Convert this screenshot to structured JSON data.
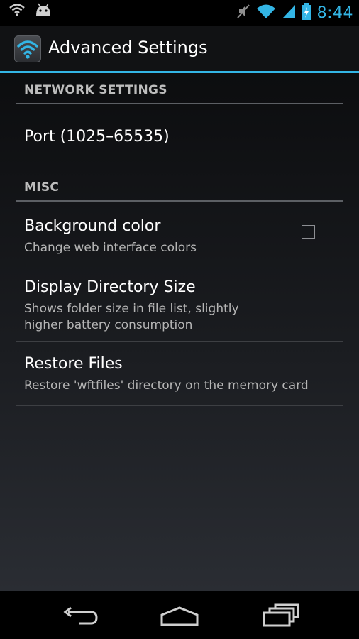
{
  "status_bar": {
    "time": "8:44",
    "icons": [
      "wifi-icon",
      "android-icon",
      "mute-icon",
      "wifi-signal-icon",
      "cell-signal-icon",
      "battery-charging-icon"
    ]
  },
  "action_bar": {
    "title": "Advanced Settings",
    "icon": "wifi-app-icon"
  },
  "sections": {
    "network": {
      "header": "NETWORK SETTINGS",
      "items": [
        {
          "title": "Port (1025–65535)"
        }
      ]
    },
    "misc": {
      "header": "MISC",
      "items": [
        {
          "title": "Background color",
          "summary": "Change web interface colors"
        },
        {
          "title": "Display Directory Size",
          "summary_line1": "Shows folder size in file list, slightly",
          "summary_line2": "higher battery consumption",
          "checked": false
        },
        {
          "title": "Restore Files",
          "summary": "Restore 'wftfiles' directory on the memory card"
        }
      ]
    }
  },
  "nav_bar": {
    "icons": [
      "back-icon",
      "home-icon",
      "recent-apps-icon"
    ]
  },
  "colors": {
    "accent": "#33b5e5",
    "text_primary": "#ffffff",
    "text_secondary": "#b5b5b5"
  }
}
